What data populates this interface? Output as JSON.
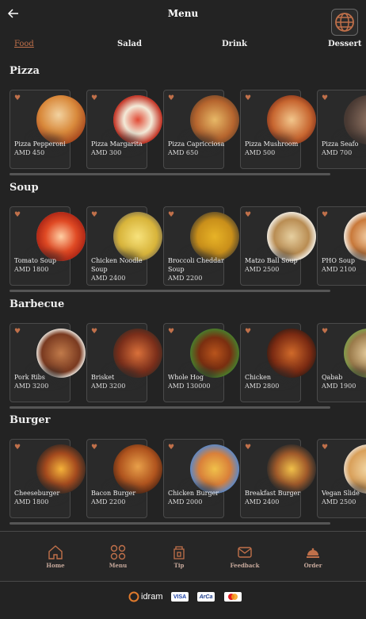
{
  "header": {
    "title": "Menu",
    "back_icon": "arrow-left-icon",
    "globe_icon": "globe-icon"
  },
  "tabs": [
    {
      "label": "Food",
      "active": true
    },
    {
      "label": "Salad",
      "active": false
    },
    {
      "label": "Drink",
      "active": false
    },
    {
      "label": "Dessert",
      "active": false
    }
  ],
  "sections": [
    {
      "title": "Pizza",
      "items": [
        {
          "name": "Pizza Pepperoni",
          "price": "AMD 450"
        },
        {
          "name": "Pizza Margarita",
          "price": "AMD 300"
        },
        {
          "name": "Pizza Capricciosa",
          "price": "AMD 650"
        },
        {
          "name": "Pizza Mushroom",
          "price": "AMD 500"
        },
        {
          "name": "Pizza Seafo",
          "price": "AMD 700"
        }
      ]
    },
    {
      "title": "Soup",
      "items": [
        {
          "name": "Tomato Soup",
          "price": "AMD 1800"
        },
        {
          "name": "Chicken Noodle Soup",
          "price": "AMD 2400"
        },
        {
          "name": "Broccoli Cheddar Soup",
          "price": "AMD 2200"
        },
        {
          "name": "Matzo Ball Soup",
          "price": "AMD 2500"
        },
        {
          "name": "PHO Soup",
          "price": "AMD 2100"
        }
      ]
    },
    {
      "title": "Barbecue",
      "items": [
        {
          "name": "Pork Ribs",
          "price": "AMD 3200"
        },
        {
          "name": "Brisket",
          "price": "AMD 3200"
        },
        {
          "name": "Whole Hog",
          "price": "AMD 130000"
        },
        {
          "name": "Chicken",
          "price": "AMD 2800"
        },
        {
          "name": "Qabab",
          "price": "AMD 1900"
        }
      ]
    },
    {
      "title": "Burger",
      "items": [
        {
          "name": "Cheeseburger",
          "price": "AMD 1800"
        },
        {
          "name": "Bacon Burger",
          "price": "AMD 2200"
        },
        {
          "name": "Chicken Burger",
          "price": "AMD 2000"
        },
        {
          "name": "Breakfast Burger",
          "price": "AMD 2400"
        },
        {
          "name": "Vegan Slide",
          "price": "AMD 2500"
        }
      ]
    }
  ],
  "nav": [
    {
      "label": "Home",
      "icon": "home-icon"
    },
    {
      "label": "Menu",
      "icon": "menu-grid-icon"
    },
    {
      "label": "Tip",
      "icon": "tip-jar-icon"
    },
    {
      "label": "Feedback",
      "icon": "mail-icon"
    },
    {
      "label": "Order",
      "icon": "cloche-icon"
    }
  ],
  "payments": {
    "idram": "idram",
    "visa": "VISA",
    "arca": "ArCa",
    "mastercard": "MasterCard"
  },
  "colors": {
    "accent": "#c0704a",
    "background": "#232323",
    "card": "#2a2a2a",
    "nav_label": "#c7a99c"
  }
}
